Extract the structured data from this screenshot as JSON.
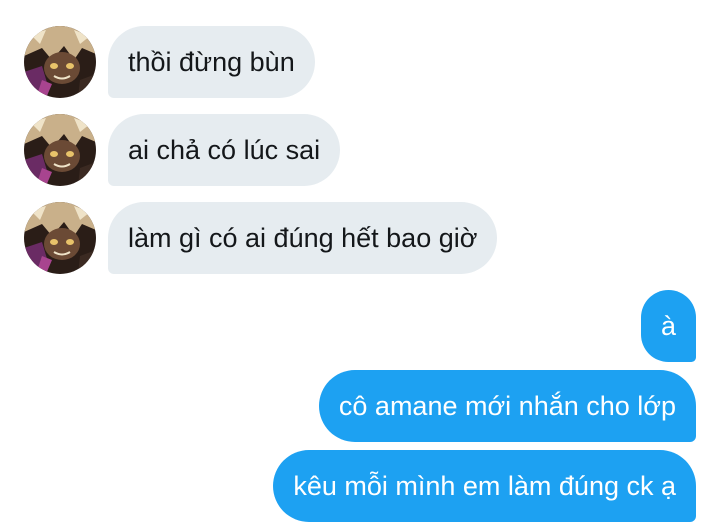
{
  "conversation": {
    "messages": [
      {
        "from": "them",
        "text": "thồi đừng bùn"
      },
      {
        "from": "them",
        "text": "ai chả có lúc sai"
      },
      {
        "from": "them",
        "text": "làm gì có ai đúng hết bao giờ"
      },
      {
        "from": "me",
        "text": "à"
      },
      {
        "from": "me",
        "text": "cô amane mới nhắn cho lớp"
      },
      {
        "from": "me",
        "text": "kêu mỗi mình em làm đúng ck ạ"
      }
    ]
  },
  "colors": {
    "incoming_bubble": "#e6ecf0",
    "incoming_text": "#14171a",
    "outgoing_bubble": "#1da1f2",
    "outgoing_text": "#ffffff"
  },
  "icons": {
    "avatar": "contact-avatar-anime"
  }
}
